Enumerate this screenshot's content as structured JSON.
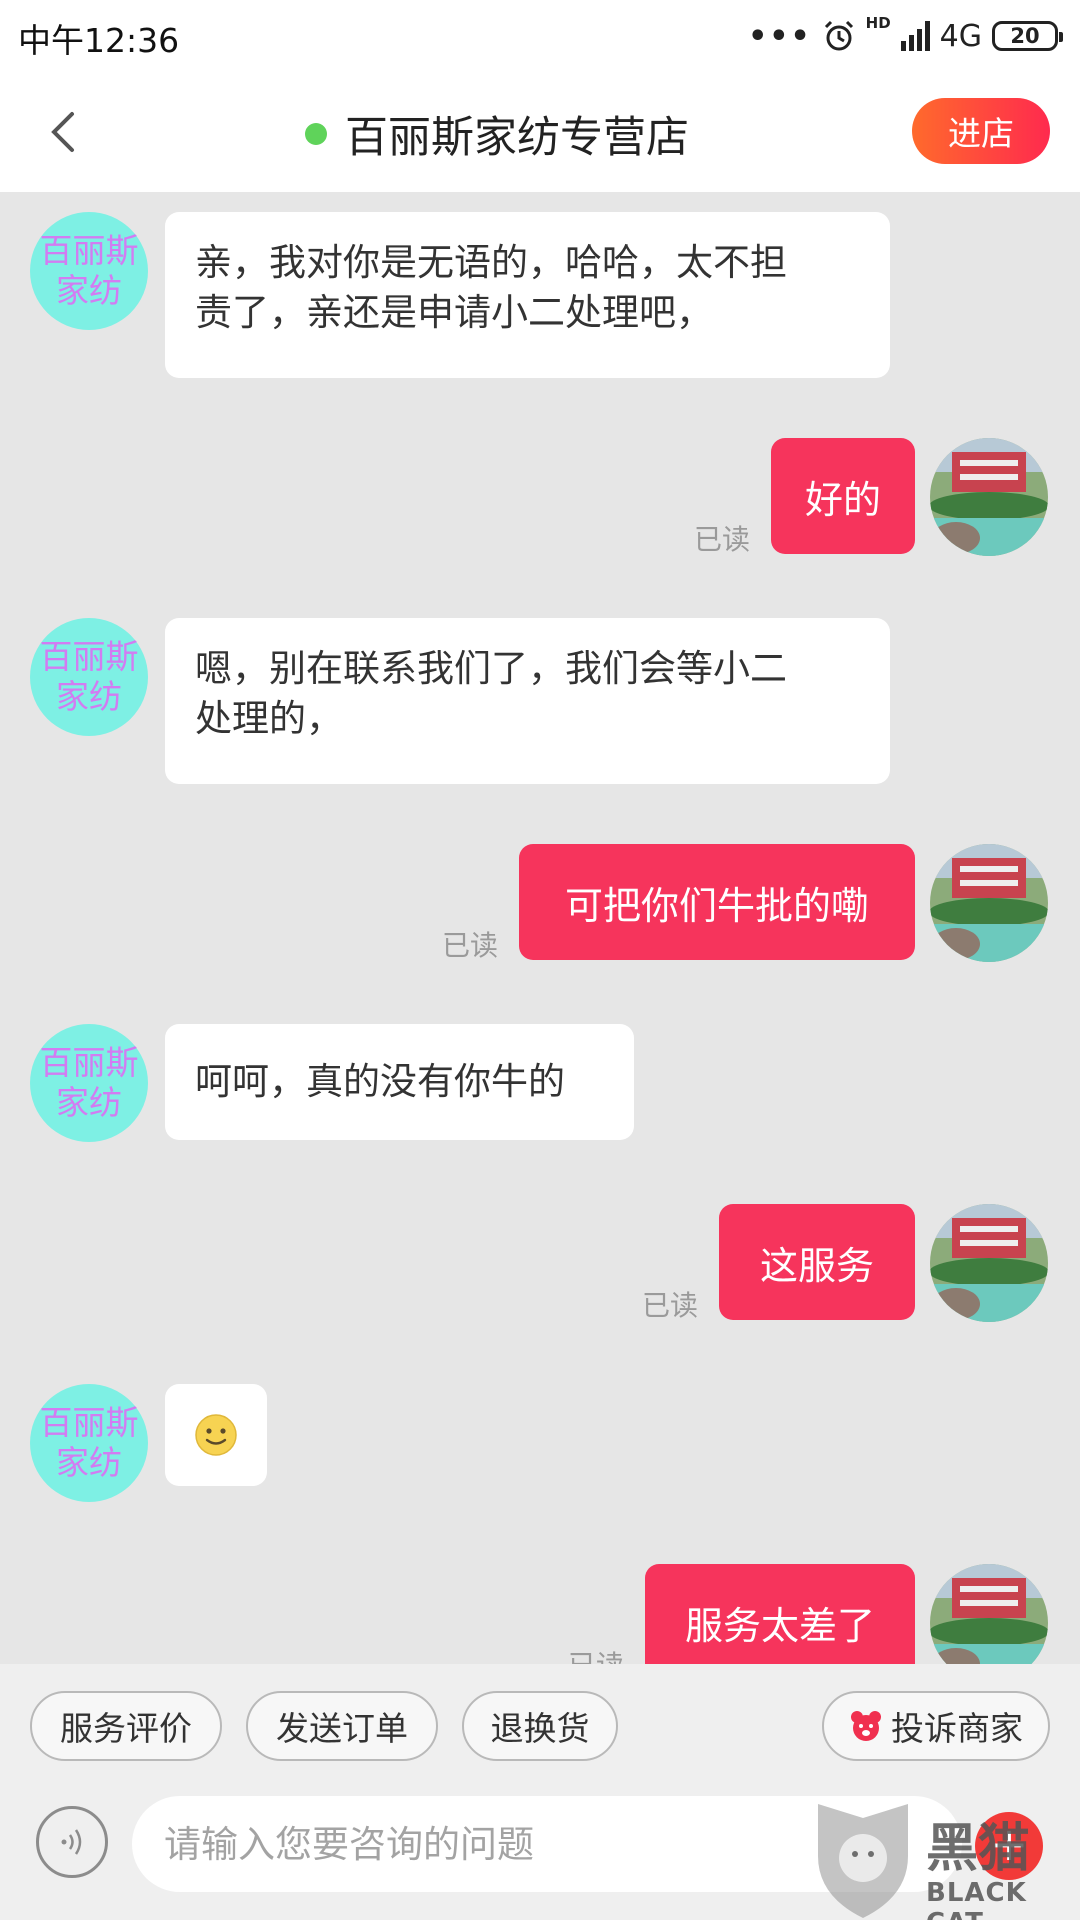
{
  "status_bar": {
    "time": "中午12:36",
    "dots": "•••",
    "hd": "HD",
    "network": "4G",
    "battery": "20"
  },
  "header": {
    "shop_name": "百丽斯家纺专营店",
    "enter_button": "进店",
    "online_color": "#5fd35a"
  },
  "shop_avatar_text": [
    "百丽斯",
    "家纺"
  ],
  "messages": [
    {
      "from": "shop",
      "text_lines": [
        "亲，我对你是无语的，哈哈，太不担",
        "责了，亲还是申请小二处理吧，"
      ]
    },
    {
      "from": "user",
      "text": "好的",
      "status": "已读"
    },
    {
      "from": "shop",
      "text_lines": [
        "嗯，别在联系我们了，我们会等小二",
        "处理的，"
      ]
    },
    {
      "from": "user",
      "text": "可把你们牛批的嘞",
      "status": "已读"
    },
    {
      "from": "shop",
      "text_lines": [
        "呵呵，真的没有你牛的"
      ]
    },
    {
      "from": "user",
      "text": "这服务",
      "status": "已读"
    },
    {
      "from": "shop",
      "emoji": "smiley-icon"
    },
    {
      "from": "user",
      "text": "服务太差了",
      "status": "已读"
    }
  ],
  "quick_actions": {
    "service_rating": "服务评价",
    "send_order": "发送订单",
    "return_exchange": "退换货",
    "complain_merchant": "投诉商家"
  },
  "input": {
    "placeholder": "请输入您要咨询的问题",
    "plus": "+"
  },
  "watermark": {
    "cn": "黑猫",
    "en": "BLACK CAT"
  },
  "colors": {
    "outgoing_bubble": "#f6345c",
    "enter_button_gradient": [
      "#ff6a2c",
      "#ff2a4e"
    ],
    "shop_avatar_bg": "#7ef0e4",
    "shop_avatar_text": "#d27cf2"
  }
}
